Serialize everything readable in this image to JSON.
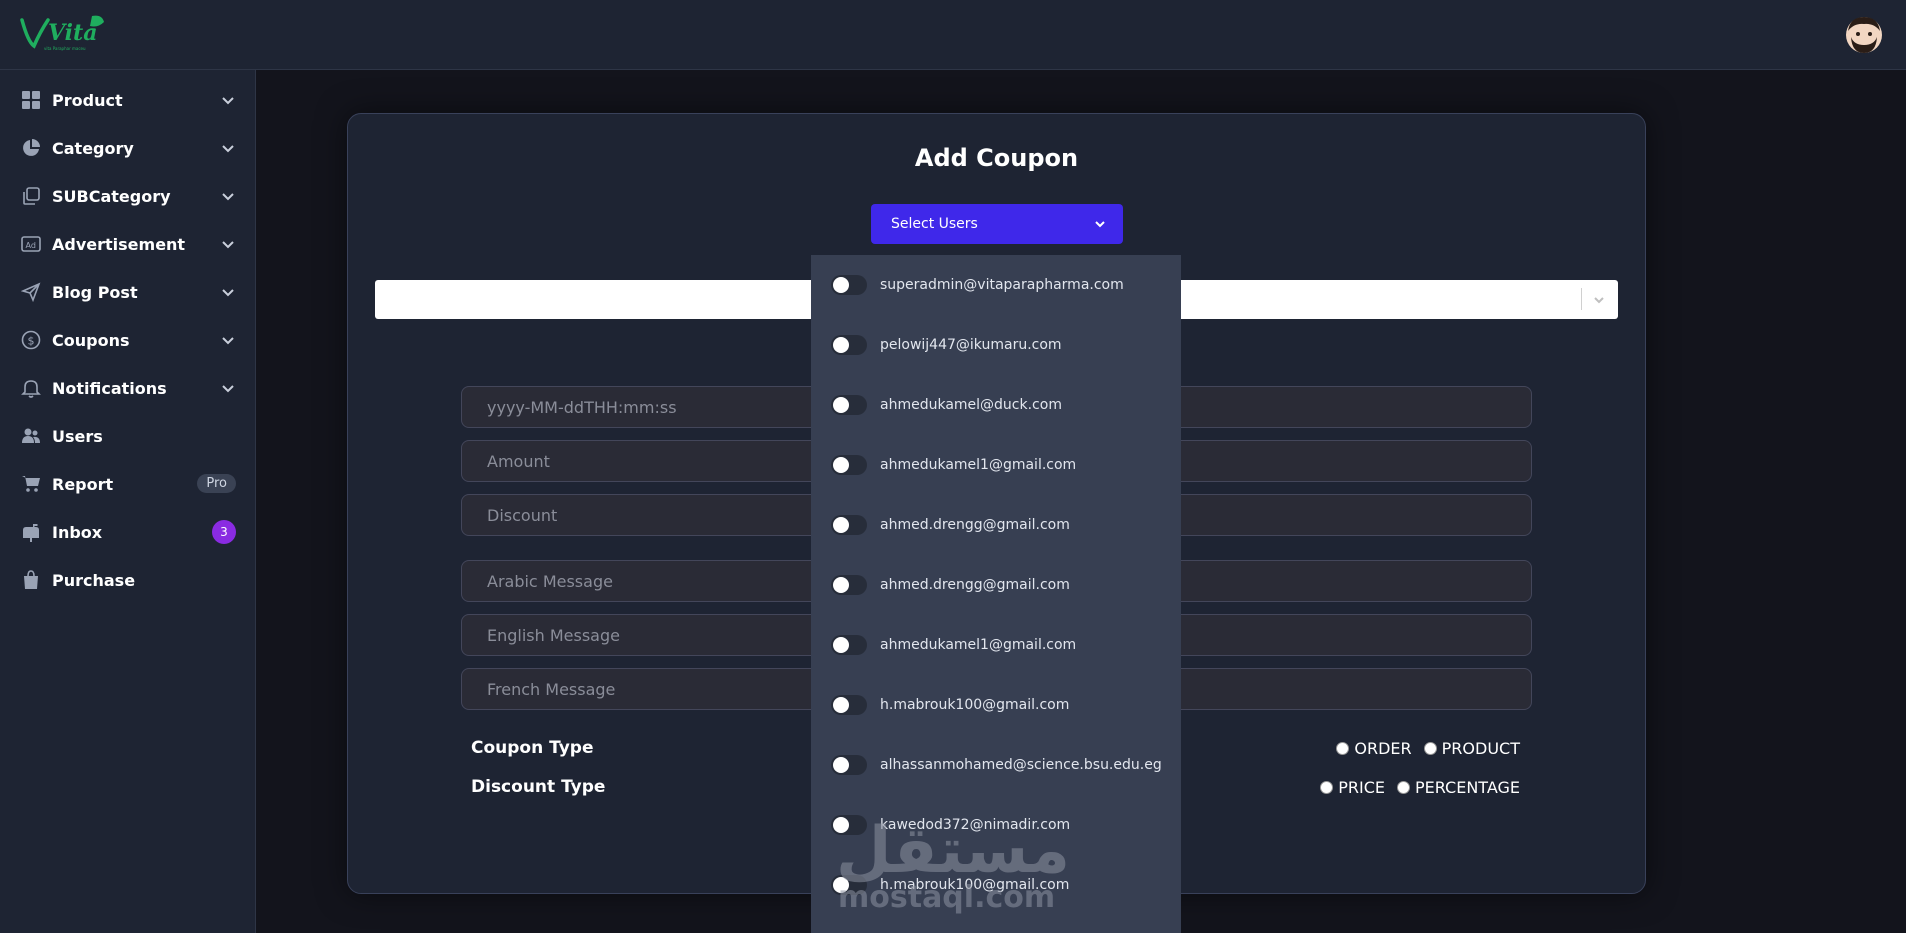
{
  "header": {
    "logo_text": "Vita",
    "logo_subtext": "vita Paraphar maceu"
  },
  "sidebar": {
    "items": [
      {
        "label": "Product",
        "icon": "grid-icon",
        "has_chevron": true
      },
      {
        "label": "Category",
        "icon": "pie-chart-icon",
        "has_chevron": true
      },
      {
        "label": "SUBCategory",
        "icon": "copy-icon",
        "has_chevron": true
      },
      {
        "label": "Advertisement",
        "icon": "ad-icon",
        "has_chevron": true
      },
      {
        "label": "Blog Post",
        "icon": "send-icon",
        "has_chevron": true
      },
      {
        "label": "Coupons",
        "icon": "dollar-icon",
        "has_chevron": true
      },
      {
        "label": "Notifications",
        "icon": "bell-icon",
        "has_chevron": true
      },
      {
        "label": "Users",
        "icon": "users-icon",
        "has_chevron": false
      },
      {
        "label": "Report",
        "icon": "cart-icon",
        "has_chevron": false,
        "pill": "Pro"
      },
      {
        "label": "Inbox",
        "icon": "mailbox-icon",
        "has_chevron": false,
        "badge": "3"
      },
      {
        "label": "Purchase",
        "icon": "bag-icon",
        "has_chevron": false
      }
    ]
  },
  "form": {
    "title": "Add Coupon",
    "select_users_label": "Select Users",
    "fields": {
      "date_placeholder": "yyyy-MM-ddTHH:mm:ss",
      "amount_placeholder": "Amount",
      "discount_placeholder": "Discount",
      "arabic_placeholder": "Arabic Message",
      "english_placeholder": "English Message",
      "french_placeholder": "French Message"
    },
    "coupon_type": {
      "label": "Coupon Type",
      "options": [
        "ORDER",
        "PRODUCT"
      ]
    },
    "discount_type": {
      "label": "Discount Type",
      "options": [
        "PRICE",
        "PERCENTAGE"
      ]
    }
  },
  "users_dropdown": {
    "items": [
      "superadmin@vitaparapharma.com",
      "pelowij447@ikumaru.com",
      "ahmedukamel@duck.com",
      "ahmedukamel1@gmail.com",
      "ahmed.drengg@gmail.com",
      "ahmed.drengg@gmail.com",
      "ahmedukamel1@gmail.com",
      "h.mabrouk100@gmail.com",
      "alhassanmohamed@science.bsu.edu.eg",
      "kawedod372@nimadir.com",
      "h.mabrouk100@gmail.com"
    ]
  },
  "watermark": {
    "latin": "mostaql.com",
    "arabic": "مستقل"
  },
  "colors": {
    "sidebar_bg": "#1e2433",
    "page_bg": "#13141c",
    "primary": "#3f28ea",
    "badge": "#8a2be2",
    "dropdown_bg": "#373f52"
  }
}
